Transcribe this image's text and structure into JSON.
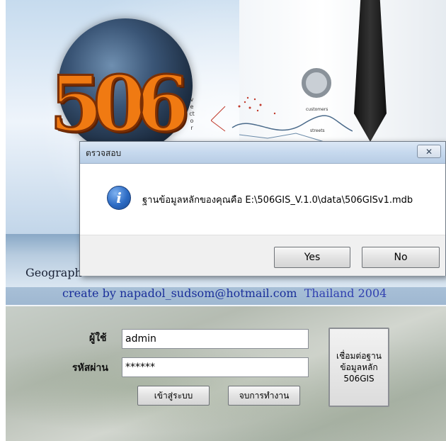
{
  "splash": {
    "logo_text": "506",
    "vector_word": "vector",
    "map_labels": [
      "customers",
      "streets"
    ],
    "geo_title": "Geograph",
    "credit": "create by napadol_sudsom@hotmail.com",
    "credit_country": "Thailand 2004"
  },
  "login": {
    "user_label": "ผู้ใช้",
    "user_value": "admin",
    "password_label": "รหัสผ่าน",
    "password_value": "******",
    "login_button": "เข้าสู่ระบบ",
    "exit_button": "จบการทำงาน",
    "connect_button_lines": [
      "เชื่อมต่อฐาน",
      "ข้อมูลหลัก",
      "506GIS"
    ]
  },
  "dialog": {
    "title": "ตรวจสอบ",
    "close_glyph": "✕",
    "icon": "info-icon",
    "message": "ฐานข้อมูลหลักของคุณคือ E:\\506GIS_V.1.0\\data\\506GISv1.mdb",
    "yes_label": "Yes",
    "no_label": "No"
  },
  "colors": {
    "logo_orange": "#f07a12",
    "credit_blue": "#1a2f9a",
    "titlebar_blue": "#c6d9ee"
  }
}
